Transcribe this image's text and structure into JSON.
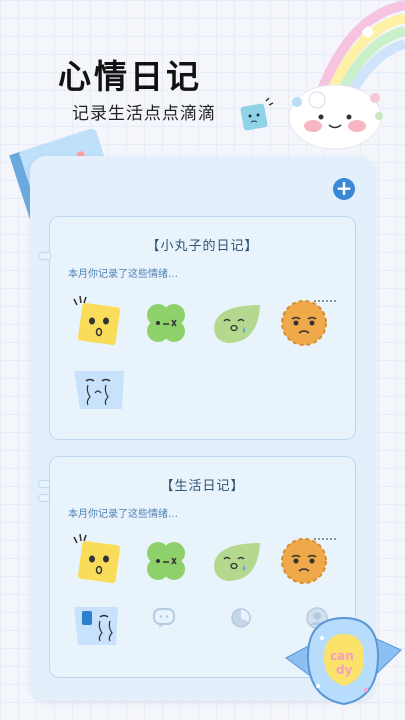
{
  "header": {
    "title": "心情日记",
    "subtitle": "记录生活点点滴滴"
  },
  "diaries": [
    {
      "title": "【小丸子的日记】",
      "subtitle": "本月你记录了这些情绪…",
      "moods": [
        "yellow-square-surprised",
        "green-clover-dizzy",
        "green-leaf-crying",
        "orange-cookie-sad",
        "blue-paper-crying"
      ]
    },
    {
      "title": "【生活日记】",
      "subtitle": "本月你记录了这些情绪…",
      "moods": [
        "yellow-square-surprised",
        "green-clover-dizzy",
        "green-leaf-crying",
        "orange-cookie-sad",
        "blue-paper-crying"
      ]
    }
  ],
  "bottom_nav": {
    "items": [
      "notebook-icon",
      "chat-icon",
      "chart-icon",
      "profile-icon"
    ]
  },
  "decorations": {
    "book_label": "diary-book",
    "candy_text": "candy",
    "rainbow": "rainbow-cloud",
    "seal": "seal-mascot"
  },
  "colors": {
    "accent": "#3b88d6",
    "card_bg": "#e3f0fb",
    "yellow": "#f9dd5a",
    "green": "#8ed16a",
    "leaf": "#b4d98e",
    "cookie": "#efa94a",
    "paper": "#c8e2fb"
  }
}
